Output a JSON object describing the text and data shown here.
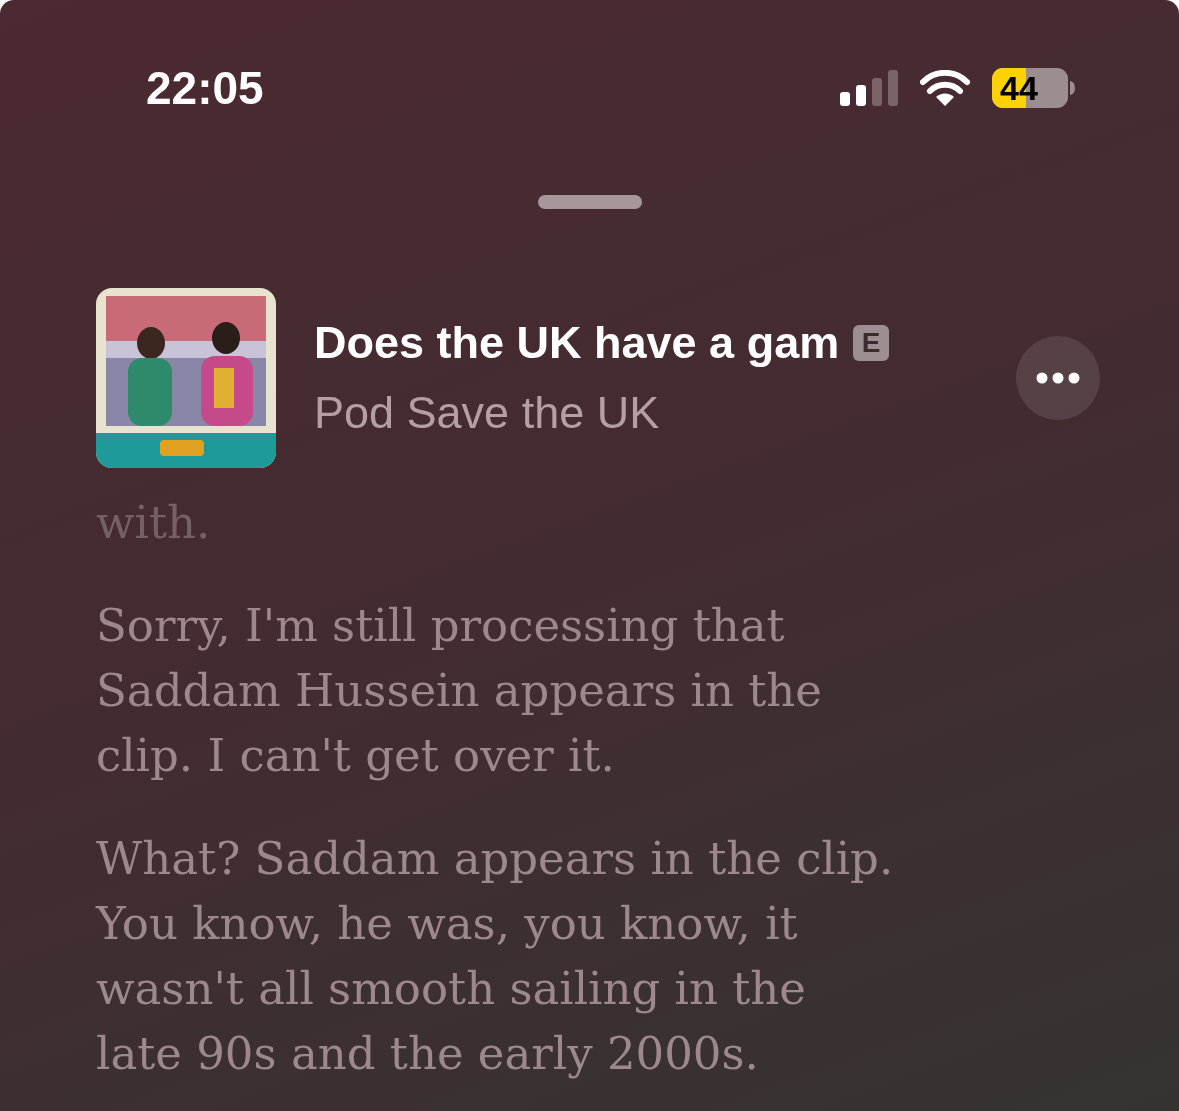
{
  "status_bar": {
    "time": "22:05",
    "battery": "44"
  },
  "now_playing": {
    "title": "Does the UK have a gam",
    "badge": "E",
    "show": "Pod Save the UK"
  },
  "transcript": [
    {
      "text": "with.",
      "faded": true
    },
    {
      "text": "Sorry, I'm still processing that Saddam Hussein appears in the clip. I can't get over it.",
      "faded": false
    },
    {
      "text": "What? Saddam appears in the clip. You know, he was, you know, it wasn't all smooth sailing in the late 90s and the early 2000s.",
      "faded": false
    }
  ]
}
